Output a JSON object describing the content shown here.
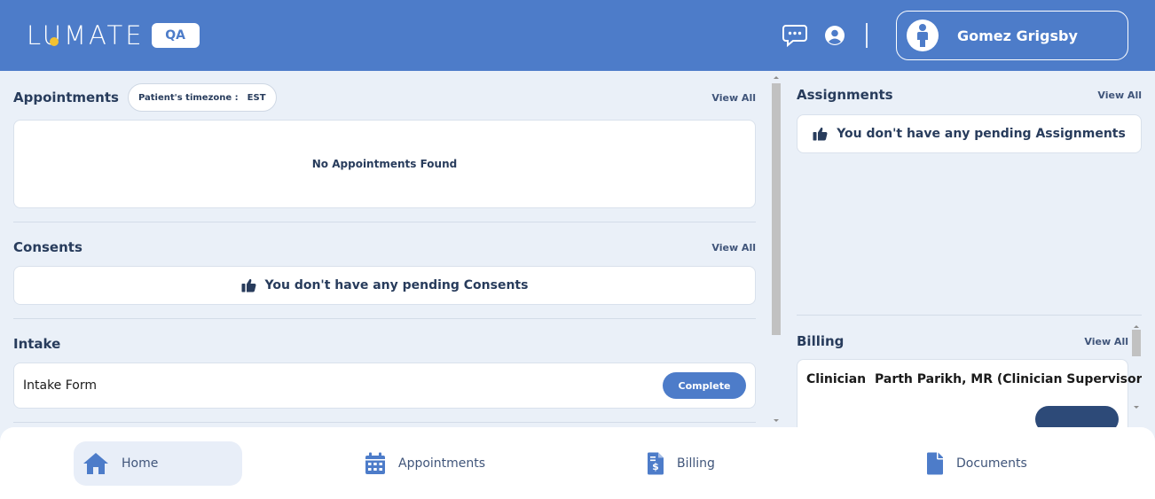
{
  "header": {
    "logo_text": "LUMATE",
    "env_badge": "QA",
    "user_name": "Gomez Grigsby"
  },
  "appointments": {
    "title": "Appointments",
    "timezone_label": "Patient's timezone :",
    "timezone_value": "EST",
    "view_all": "View All",
    "empty_message": "No Appointments Found"
  },
  "consents": {
    "title": "Consents",
    "view_all": "View All",
    "empty_message": "You don't have any pending Consents"
  },
  "intake": {
    "title": "Intake",
    "form_name": "Intake Form",
    "action_label": "Complete"
  },
  "assignments": {
    "title": "Assignments",
    "view_all": "View All",
    "empty_message": "You don't have any pending Assignments"
  },
  "billing": {
    "title": "Billing",
    "view_all": "View All",
    "clinician_label": "Clinician",
    "clinician_value": "Parth Parikh, MR (Clinician Supervisor)"
  },
  "nav": [
    {
      "label": "Home",
      "icon": "home-icon",
      "active": true
    },
    {
      "label": "Appointments",
      "icon": "calendar-icon",
      "active": false
    },
    {
      "label": "Billing",
      "icon": "invoice-dollar-icon",
      "active": false
    },
    {
      "label": "Documents",
      "icon": "document-icon",
      "active": false
    }
  ],
  "colors": {
    "brand": "#4d7cc9",
    "logo_accent": "#f2c231",
    "text_dark": "#283c5c",
    "background": "#eaf0f8"
  }
}
